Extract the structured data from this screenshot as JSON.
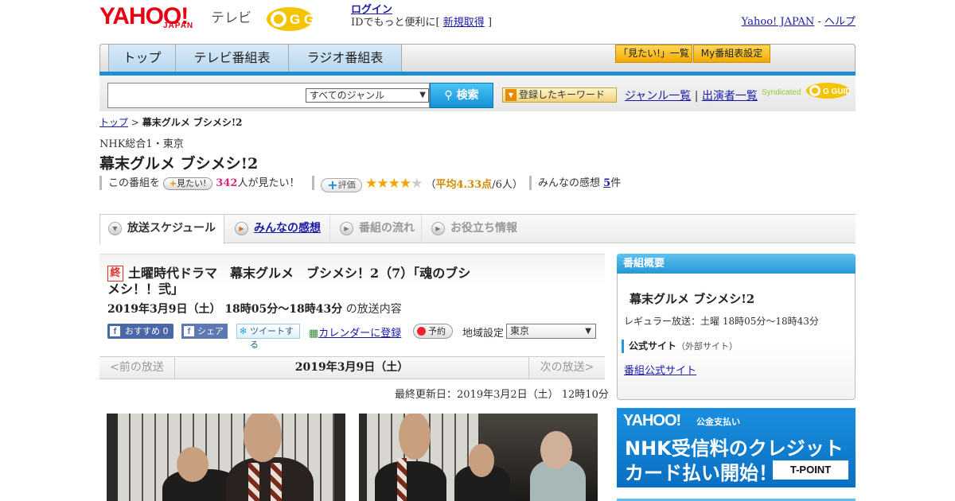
{
  "header": {
    "logo_yahoo": "YAHOO!",
    "logo_japan": "JAPAN",
    "logo_tv": "テレビ",
    "logo_gguide": "G GUIDE",
    "login": "ログイン",
    "login_note_prefix": "IDでもっと便利に[",
    "register": "新規取得",
    "login_note_suffix": "]",
    "yahoo_japan_link": "Yahoo! JAPAN",
    "separator": "-",
    "help_link": "ヘルプ"
  },
  "nav": {
    "tabs": [
      "トップ",
      "テレビ番組表",
      "ラジオ番組表"
    ],
    "mitai_list": "「見たい!」一覧",
    "my_table": "My番組表設定"
  },
  "search": {
    "genre": "すべてのジャンル",
    "button": "検索",
    "keyword_button": "登録したキーワード",
    "genre_list": "ジャンル一覧",
    "divider": "|",
    "performer_list": "出演者一覧",
    "syndicated": "Syndicated",
    "gguide": "G GUIDE"
  },
  "breadcrumb": {
    "top": "トップ",
    "sep": ">",
    "current": "幕末グルメ ブシメシ!2"
  },
  "program": {
    "channel": "NHK総合1・東京",
    "title": "幕末グルメ ブシメシ!2",
    "want_prefix": "この番組を",
    "want_button": "見たい!",
    "want_count": "342",
    "want_suffix": "人が見たい！",
    "rate_button": "評価",
    "stars_on": "★★★★",
    "stars_off": "★",
    "rating_open": "（",
    "rating_avg": "平均4.33点",
    "rating_count": "/6人）",
    "impressions_label": "みんなの感想",
    "impressions_count": "5",
    "impressions_suffix": "件"
  },
  "subtabs": [
    "放送スケジュール",
    "みんなの感想",
    "番組の流れ",
    "お役立ち情報"
  ],
  "episode": {
    "badge": "終",
    "title": "土曜時代ドラマ　幕末グルメ　ブシメシ！2（7）「魂のブシメシ！！弐」",
    "date": "2019年3月9日（土）  18時05分～18時43分",
    "date_suffix": "の放送内容",
    "fb_recommend": "おすすめ 0",
    "fb_share": "シェア",
    "tweet": "ツイートする",
    "calendar": "カレンダーに登録",
    "reserve": "予約",
    "region_label": "地域設定",
    "region": "東京"
  },
  "pager": {
    "prev": "<前の放送",
    "current": "2019年3月9日（土）",
    "next": "次の放送>"
  },
  "updated": "最終更新日：2019年3月2日（土）  12時10分",
  "sidebar": {
    "heading": "番組概要",
    "title": "幕末グルメ ブシメシ!2",
    "regular": "レギュラー放送：土曜 18時05分～18時43分",
    "official_label": "公式サイト",
    "official_note": "（外部サイト）",
    "official_link": "番組公式サイト"
  },
  "ad": {
    "brand": "YAHOO!",
    "sub": "公金支払い",
    "line1": "NHK受信料のクレジット",
    "line2": "カード払い開始！",
    "tpoint": "T-POINT"
  }
}
